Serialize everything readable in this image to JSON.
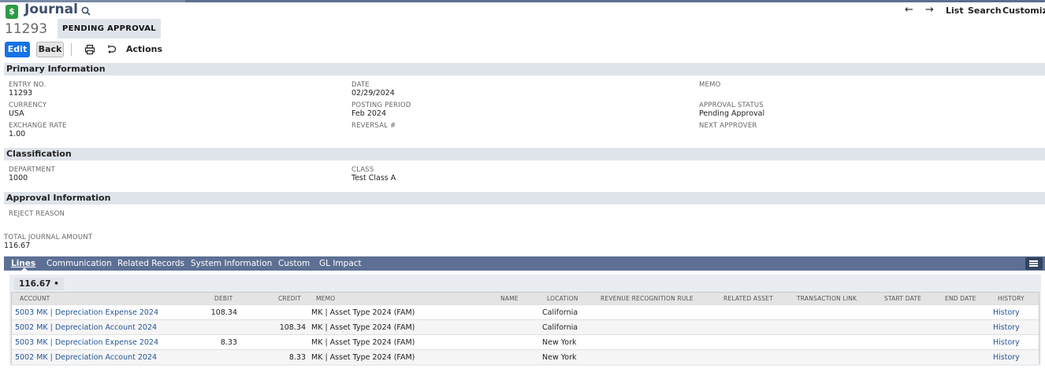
{
  "header": {
    "title": "Journal",
    "record_number": "11293",
    "status": "PENDING APPROVAL",
    "nav": {
      "list": "List",
      "search": "Search",
      "customize": "Customize"
    }
  },
  "toolbar": {
    "edit": "Edit",
    "back": "Back",
    "actions": "Actions"
  },
  "primary": {
    "section_title": "Primary Information",
    "entry_no": {
      "label": "ENTRY NO.",
      "value": "11293"
    },
    "currency": {
      "label": "CURRENCY",
      "value": "USA"
    },
    "exchange_rate": {
      "label": "EXCHANGE RATE",
      "value": "1.00"
    },
    "date": {
      "label": "DATE",
      "value": "02/29/2024"
    },
    "posting_period": {
      "label": "POSTING PERIOD",
      "value": "Feb 2024"
    },
    "reversal": {
      "label": "REVERSAL #",
      "value": ""
    },
    "memo": {
      "label": "MEMO",
      "value": ""
    },
    "approval_status": {
      "label": "APPROVAL STATUS",
      "value": "Pending Approval"
    },
    "next_approver": {
      "label": "NEXT APPROVER",
      "value": ""
    }
  },
  "classification": {
    "section_title": "Classification",
    "department": {
      "label": "DEPARTMENT",
      "value": "1000"
    },
    "class": {
      "label": "CLASS",
      "value": "Test Class A"
    }
  },
  "approval": {
    "section_title": "Approval Information",
    "reject_reason": {
      "label": "REJECT REASON",
      "value": ""
    }
  },
  "total": {
    "label": "TOTAL JOURNAL AMOUNT",
    "value": "116.67"
  },
  "tabs": [
    {
      "label": "Lines"
    },
    {
      "label": "Communication"
    },
    {
      "label": "Related Records"
    },
    {
      "label": "System Information"
    },
    {
      "label": "Custom"
    },
    {
      "label": "GL Impact"
    }
  ],
  "lines": {
    "total_chip": "116.67 •",
    "columns": [
      "ACCOUNT",
      "DEBIT",
      "CREDIT",
      "MEMO",
      "NAME",
      "LOCATION",
      "REVENUE RECOGNITION RULE",
      "RELATED ASSET",
      "TRANSACTION LINK",
      "START DATE",
      "END DATE",
      "HISTORY"
    ],
    "rows": [
      {
        "account": "5003 MK | Depreciation Expense 2024",
        "debit": "108.34",
        "credit": "",
        "memo": "MK | Asset Type 2024 (FAM)",
        "location": "California",
        "history": "History"
      },
      {
        "account": "5002 MK | Depreciation Account 2024",
        "debit": "",
        "credit": "108.34",
        "memo": "MK | Asset Type 2024 (FAM)",
        "location": "California",
        "history": "History"
      },
      {
        "account": "5003 MK | Depreciation Expense 2024",
        "debit": "8.33",
        "credit": "",
        "memo": "MK | Asset Type 2024 (FAM)",
        "location": "New York",
        "history": "History"
      },
      {
        "account": "5002 MK | Depreciation Account 2024",
        "debit": "",
        "credit": "8.33",
        "memo": "MK | Asset Type 2024 (FAM)",
        "location": "New York",
        "history": "History"
      }
    ]
  }
}
